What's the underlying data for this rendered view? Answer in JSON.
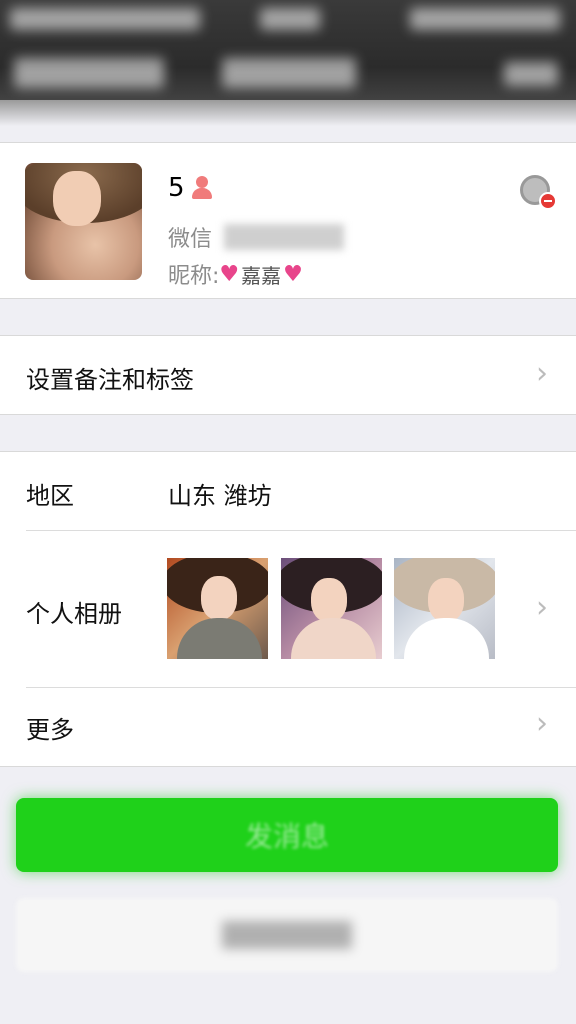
{
  "profile": {
    "name": "5",
    "wechat_label": "微信",
    "nickname_label": "昵称:",
    "nickname_left_icon": "pink-heart-icon",
    "nickname_text": "嘉嘉",
    "nickname_right_icon": "pink-heart-icon"
  },
  "rows": {
    "remark_label": "设置备注和标签",
    "region_label": "地区",
    "region_value": "山东 潍坊",
    "album_label": "个人相册",
    "more_label": "更多"
  },
  "buttons": {
    "send_label": "发消息"
  },
  "colors": {
    "accent_green": "#1fd11a",
    "gender_icon": "#f07b7b",
    "heart": "#e8458b"
  }
}
